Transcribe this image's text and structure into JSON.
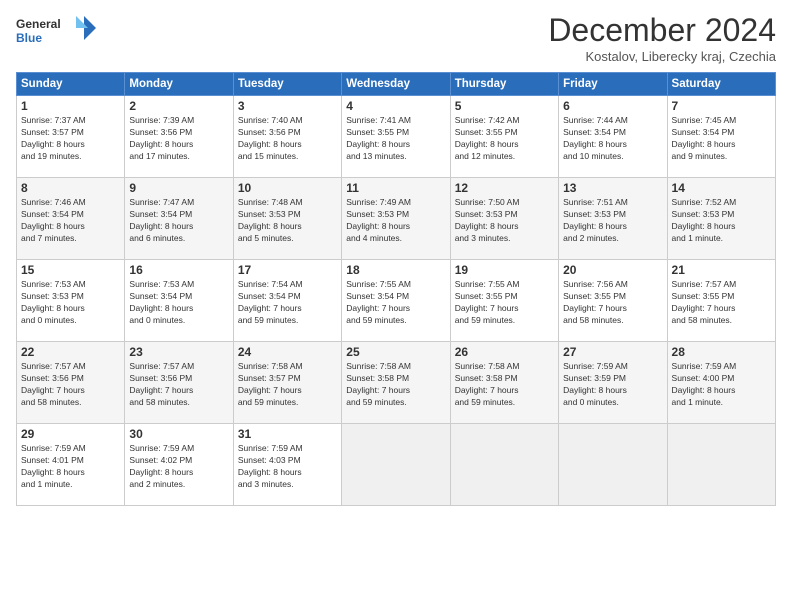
{
  "header": {
    "logo_line1": "General",
    "logo_line2": "Blue",
    "month_title": "December 2024",
    "location": "Kostalov, Liberecky kraj, Czechia"
  },
  "weekdays": [
    "Sunday",
    "Monday",
    "Tuesday",
    "Wednesday",
    "Thursday",
    "Friday",
    "Saturday"
  ],
  "weeks": [
    [
      {
        "day": "1",
        "info": "Sunrise: 7:37 AM\nSunset: 3:57 PM\nDaylight: 8 hours\nand 19 minutes."
      },
      {
        "day": "2",
        "info": "Sunrise: 7:39 AM\nSunset: 3:56 PM\nDaylight: 8 hours\nand 17 minutes."
      },
      {
        "day": "3",
        "info": "Sunrise: 7:40 AM\nSunset: 3:56 PM\nDaylight: 8 hours\nand 15 minutes."
      },
      {
        "day": "4",
        "info": "Sunrise: 7:41 AM\nSunset: 3:55 PM\nDaylight: 8 hours\nand 13 minutes."
      },
      {
        "day": "5",
        "info": "Sunrise: 7:42 AM\nSunset: 3:55 PM\nDaylight: 8 hours\nand 12 minutes."
      },
      {
        "day": "6",
        "info": "Sunrise: 7:44 AM\nSunset: 3:54 PM\nDaylight: 8 hours\nand 10 minutes."
      },
      {
        "day": "7",
        "info": "Sunrise: 7:45 AM\nSunset: 3:54 PM\nDaylight: 8 hours\nand 9 minutes."
      }
    ],
    [
      {
        "day": "8",
        "info": "Sunrise: 7:46 AM\nSunset: 3:54 PM\nDaylight: 8 hours\nand 7 minutes."
      },
      {
        "day": "9",
        "info": "Sunrise: 7:47 AM\nSunset: 3:54 PM\nDaylight: 8 hours\nand 6 minutes."
      },
      {
        "day": "10",
        "info": "Sunrise: 7:48 AM\nSunset: 3:53 PM\nDaylight: 8 hours\nand 5 minutes."
      },
      {
        "day": "11",
        "info": "Sunrise: 7:49 AM\nSunset: 3:53 PM\nDaylight: 8 hours\nand 4 minutes."
      },
      {
        "day": "12",
        "info": "Sunrise: 7:50 AM\nSunset: 3:53 PM\nDaylight: 8 hours\nand 3 minutes."
      },
      {
        "day": "13",
        "info": "Sunrise: 7:51 AM\nSunset: 3:53 PM\nDaylight: 8 hours\nand 2 minutes."
      },
      {
        "day": "14",
        "info": "Sunrise: 7:52 AM\nSunset: 3:53 PM\nDaylight: 8 hours\nand 1 minute."
      }
    ],
    [
      {
        "day": "15",
        "info": "Sunrise: 7:53 AM\nSunset: 3:53 PM\nDaylight: 8 hours\nand 0 minutes."
      },
      {
        "day": "16",
        "info": "Sunrise: 7:53 AM\nSunset: 3:54 PM\nDaylight: 8 hours\nand 0 minutes."
      },
      {
        "day": "17",
        "info": "Sunrise: 7:54 AM\nSunset: 3:54 PM\nDaylight: 7 hours\nand 59 minutes."
      },
      {
        "day": "18",
        "info": "Sunrise: 7:55 AM\nSunset: 3:54 PM\nDaylight: 7 hours\nand 59 minutes."
      },
      {
        "day": "19",
        "info": "Sunrise: 7:55 AM\nSunset: 3:55 PM\nDaylight: 7 hours\nand 59 minutes."
      },
      {
        "day": "20",
        "info": "Sunrise: 7:56 AM\nSunset: 3:55 PM\nDaylight: 7 hours\nand 58 minutes."
      },
      {
        "day": "21",
        "info": "Sunrise: 7:57 AM\nSunset: 3:55 PM\nDaylight: 7 hours\nand 58 minutes."
      }
    ],
    [
      {
        "day": "22",
        "info": "Sunrise: 7:57 AM\nSunset: 3:56 PM\nDaylight: 7 hours\nand 58 minutes."
      },
      {
        "day": "23",
        "info": "Sunrise: 7:57 AM\nSunset: 3:56 PM\nDaylight: 7 hours\nand 58 minutes."
      },
      {
        "day": "24",
        "info": "Sunrise: 7:58 AM\nSunset: 3:57 PM\nDaylight: 7 hours\nand 59 minutes."
      },
      {
        "day": "25",
        "info": "Sunrise: 7:58 AM\nSunset: 3:58 PM\nDaylight: 7 hours\nand 59 minutes."
      },
      {
        "day": "26",
        "info": "Sunrise: 7:58 AM\nSunset: 3:58 PM\nDaylight: 7 hours\nand 59 minutes."
      },
      {
        "day": "27",
        "info": "Sunrise: 7:59 AM\nSunset: 3:59 PM\nDaylight: 8 hours\nand 0 minutes."
      },
      {
        "day": "28",
        "info": "Sunrise: 7:59 AM\nSunset: 4:00 PM\nDaylight: 8 hours\nand 1 minute."
      }
    ],
    [
      {
        "day": "29",
        "info": "Sunrise: 7:59 AM\nSunset: 4:01 PM\nDaylight: 8 hours\nand 1 minute."
      },
      {
        "day": "30",
        "info": "Sunrise: 7:59 AM\nSunset: 4:02 PM\nDaylight: 8 hours\nand 2 minutes."
      },
      {
        "day": "31",
        "info": "Sunrise: 7:59 AM\nSunset: 4:03 PM\nDaylight: 8 hours\nand 3 minutes."
      },
      null,
      null,
      null,
      null
    ]
  ]
}
